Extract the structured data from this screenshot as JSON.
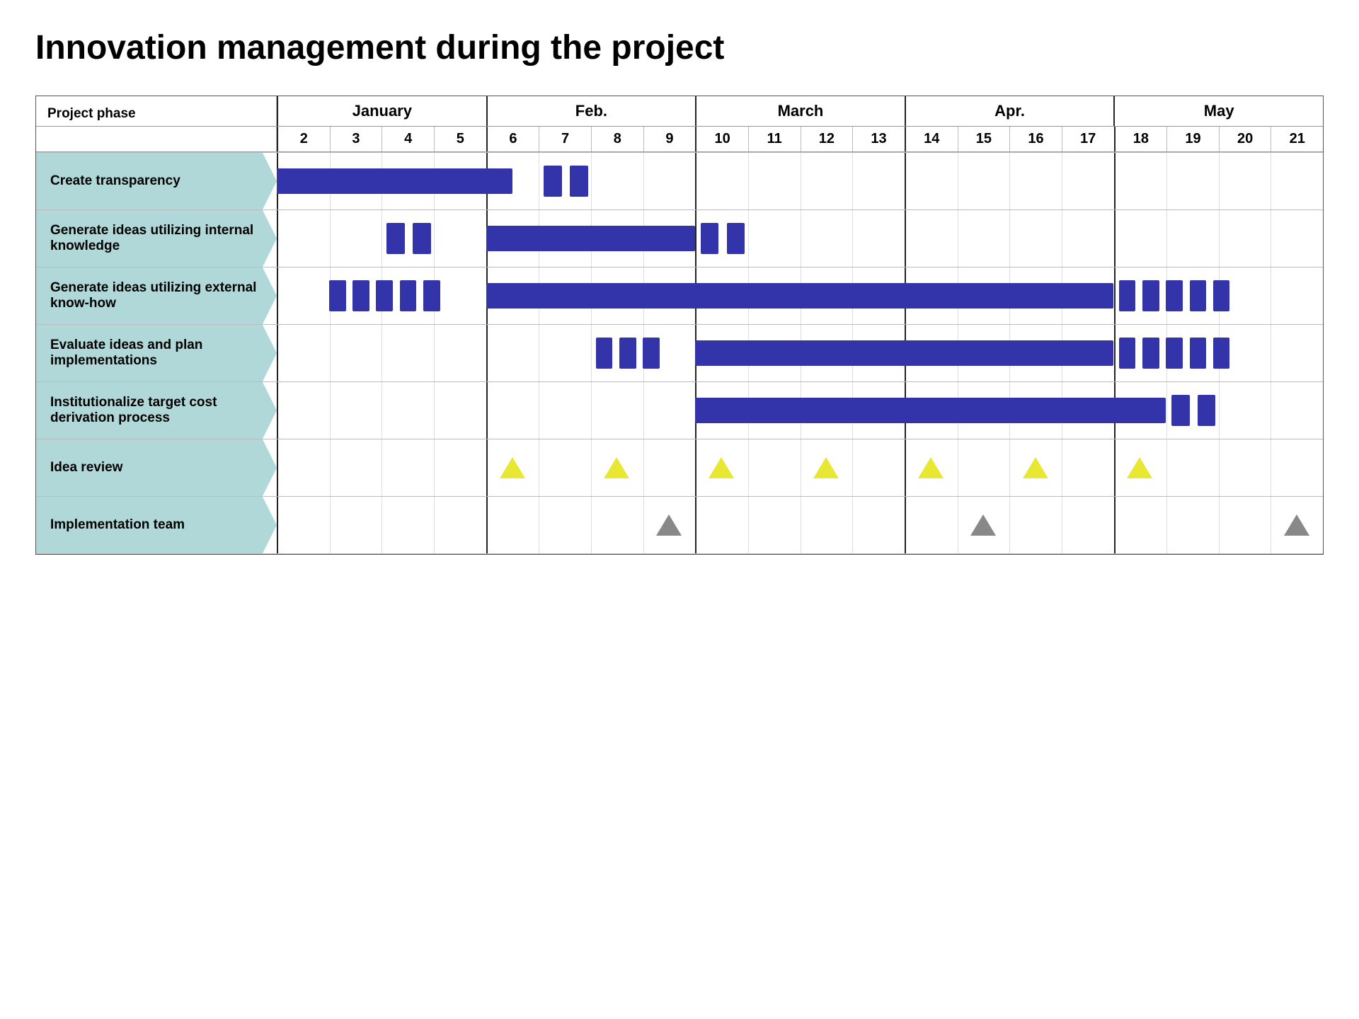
{
  "title": "Innovation management during the project",
  "header": {
    "project_phase_label": "Project phase",
    "months": [
      {
        "name": "January",
        "weeks": [
          "2",
          "3",
          "4",
          "5"
        ],
        "col_count": 4
      },
      {
        "name": "Feb.",
        "weeks": [
          "6",
          "7",
          "8",
          "9"
        ],
        "col_count": 4
      },
      {
        "name": "March",
        "weeks": [
          "10",
          "11",
          "12",
          "13"
        ],
        "col_count": 4
      },
      {
        "name": "Apr.",
        "weeks": [
          "14",
          "15",
          "16",
          "17"
        ],
        "col_count": 4
      },
      {
        "name": "May",
        "weeks": [
          "18",
          "19",
          "20",
          "21"
        ],
        "col_count": 4
      }
    ]
  },
  "rows": [
    {
      "label": "Create transparency",
      "type": "bar_row"
    },
    {
      "label": "Generate ideas utilizing internal knowledge",
      "type": "bar_row"
    },
    {
      "label": "Generate ideas utilizing external know-how",
      "type": "bar_row"
    },
    {
      "label": "Evaluate ideas and plan implementations",
      "type": "bar_row"
    },
    {
      "label": "Institutionalize target cost derivation process",
      "type": "bar_row"
    },
    {
      "label": "Idea review",
      "type": "milestone_row"
    },
    {
      "label": "Implementation team",
      "type": "milestone_row"
    }
  ]
}
